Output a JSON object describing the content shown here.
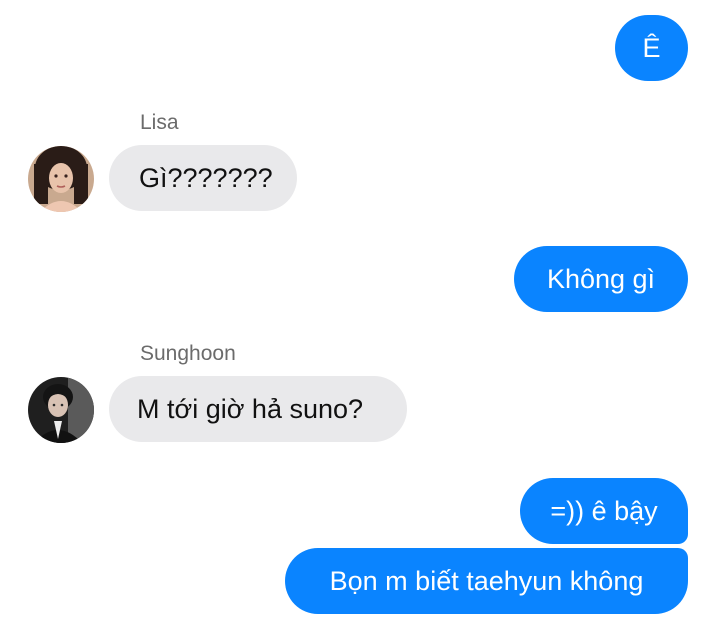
{
  "messages": [
    {
      "sender": "me",
      "text": "Ê"
    },
    {
      "sender": "Lisa",
      "sender_label": "Lisa",
      "text": "Gì???????"
    },
    {
      "sender": "me",
      "text": "Không gì"
    },
    {
      "sender": "Sunghoon",
      "sender_label": "Sunghoon",
      "text": "M tới giờ hả suno?"
    },
    {
      "sender": "me",
      "text": "=)) ê bậy"
    },
    {
      "sender": "me",
      "text": "Bọn m biết taehyun không"
    }
  ],
  "colors": {
    "outgoing_bubble": "#0a84ff",
    "incoming_bubble": "#e9e9eb",
    "sender_label": "#6b6b6b"
  },
  "icons": {
    "lisa_avatar": "avatar-photo",
    "sunghoon_avatar": "avatar-photo"
  }
}
